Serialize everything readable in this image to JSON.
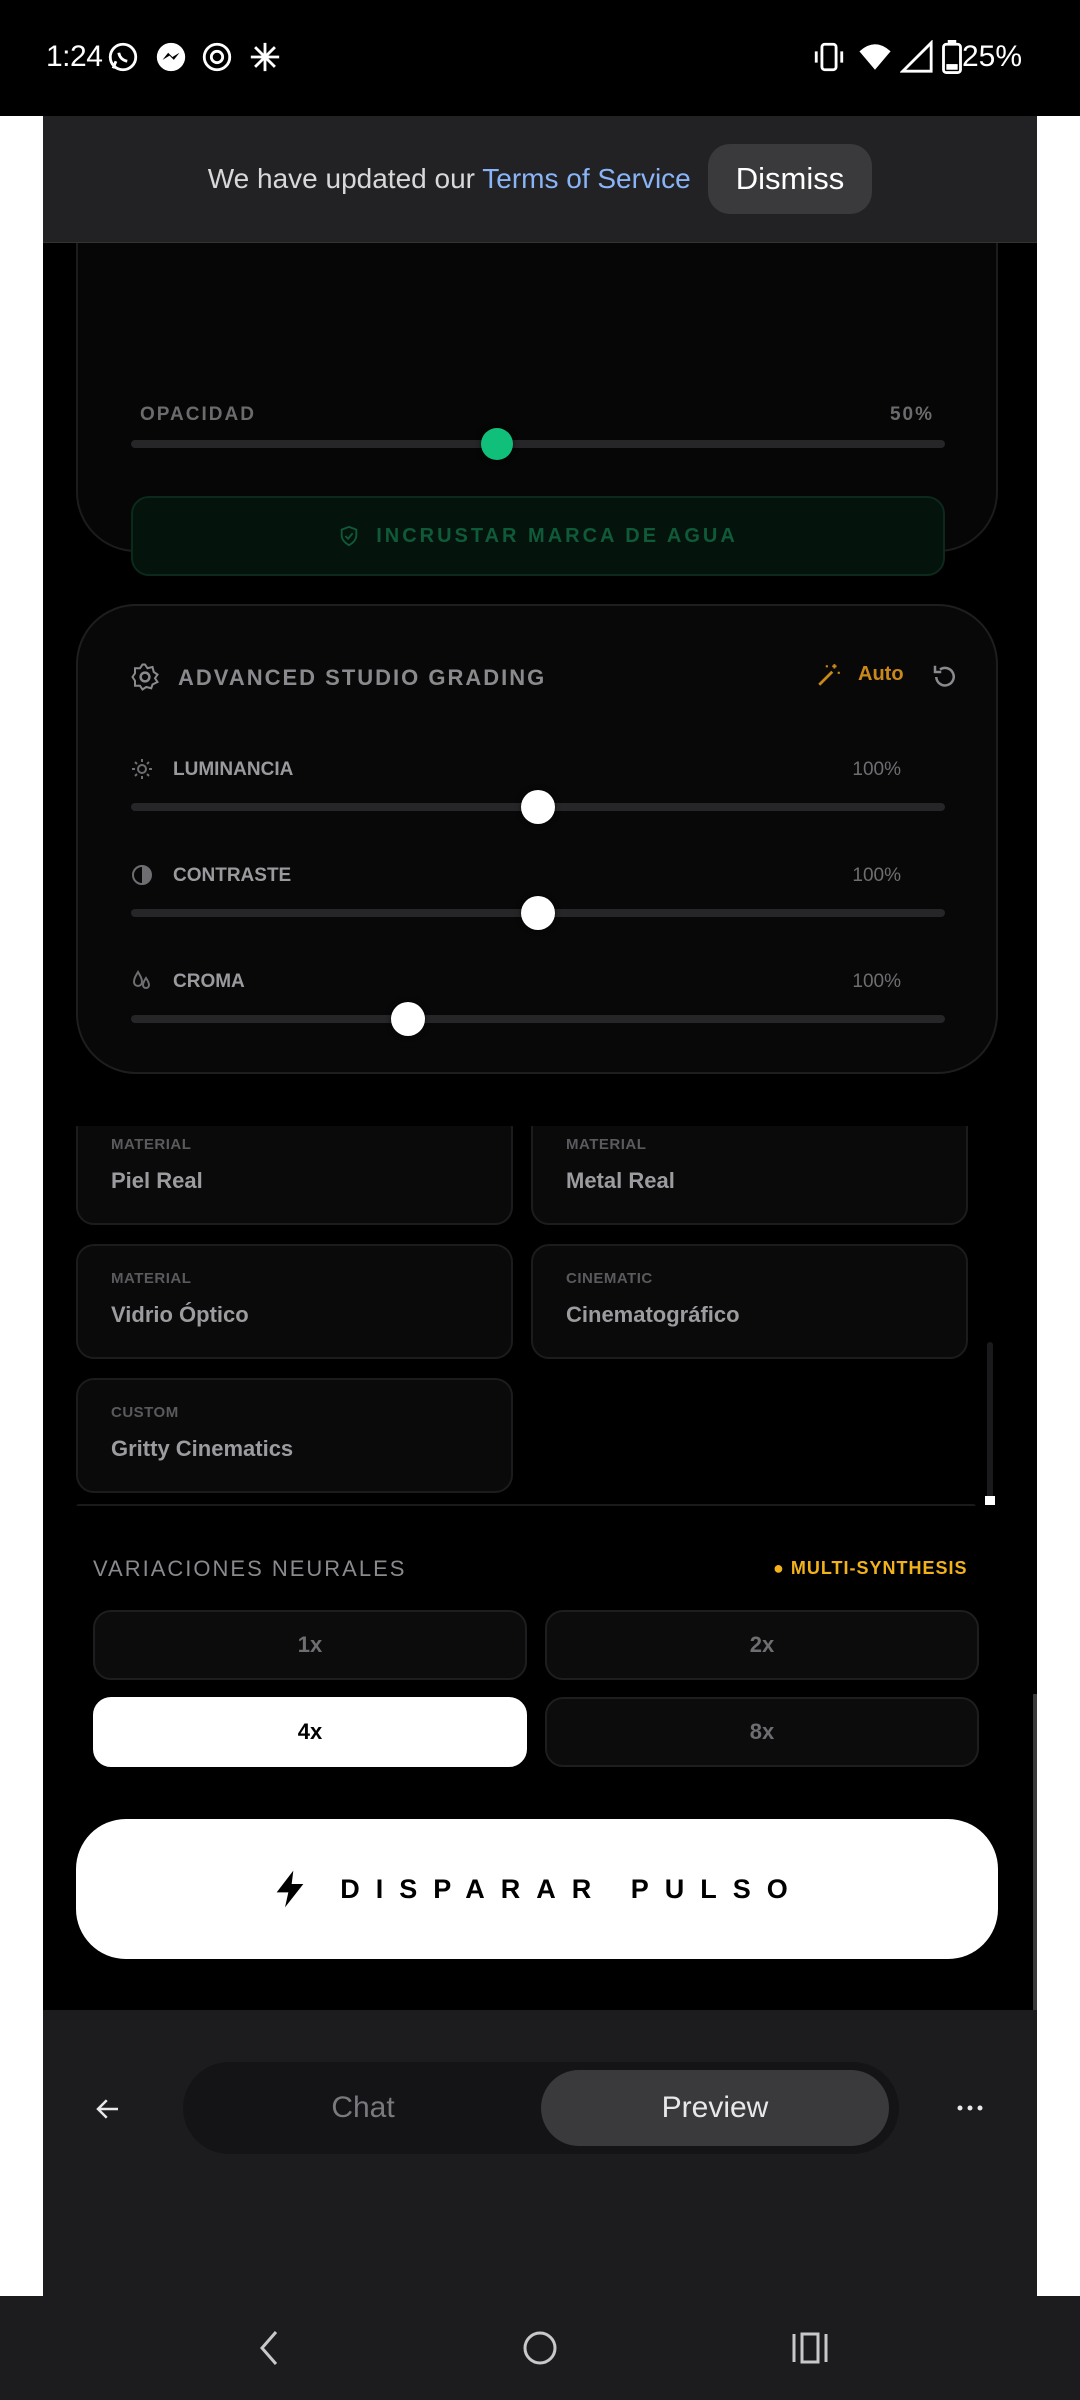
{
  "status_bar": {
    "time": "1:24",
    "battery": "25%",
    "left_icons": [
      "whatsapp-icon",
      "messenger-icon",
      "openai-icon",
      "spark-app-icon"
    ],
    "right_icons": [
      "vibrate-icon",
      "wifi-icon",
      "signal-icon",
      "battery-icon"
    ]
  },
  "banner": {
    "text": "We have updated our ",
    "link": "Terms of Service",
    "dismiss": "Dismiss"
  },
  "watermark": {
    "opacity_label": "OPACIDAD",
    "opacity_value": "50%",
    "opacity_fraction": 0.45,
    "button_label": "INCRUSTAR MARCA DE AGUA"
  },
  "grading": {
    "title": "ADVANCED STUDIO GRADING",
    "auto_label": "Auto",
    "sliders": [
      {
        "label": "LUMINANCIA",
        "value": "100%",
        "fraction": 0.5,
        "icon": "sun-icon"
      },
      {
        "label": "CONTRASTE",
        "value": "100%",
        "fraction": 0.5,
        "icon": "contrast-icon"
      },
      {
        "label": "CROMA",
        "value": "100%",
        "fraction": 0.34,
        "icon": "droplets-icon"
      }
    ]
  },
  "presets": [
    {
      "category": "MATERIAL",
      "name": "Piel Real"
    },
    {
      "category": "MATERIAL",
      "name": "Metal Real"
    },
    {
      "category": "MATERIAL",
      "name": "Vidrio Óptico"
    },
    {
      "category": "CINEMATIC",
      "name": "Cinematográfico"
    },
    {
      "category": "CUSTOM",
      "name": "Gritty Cinematics"
    }
  ],
  "variations": {
    "title": "VARIACIONES NEURALES",
    "badge": "● MULTI-SYNTHESIS",
    "options": [
      "1x",
      "2x",
      "4x",
      "8x"
    ],
    "selected": "4x"
  },
  "fire_button": {
    "label": "DISPARAR PULSO"
  },
  "bottom_bar": {
    "chat": "Chat",
    "preview": "Preview",
    "active": "Preview"
  },
  "colors": {
    "accent_green": "#10c07a",
    "accent_gold": "#f2b21c",
    "link_blue": "#8ab4f8"
  }
}
